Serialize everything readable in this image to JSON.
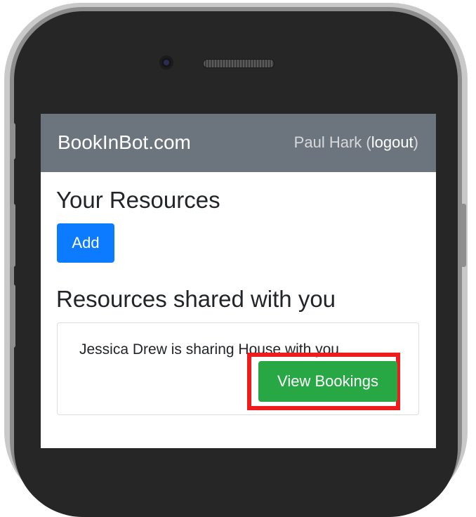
{
  "navbar": {
    "brand": "BookInBot.com",
    "user_name": "Paul Hark (",
    "logout_label": "logout",
    "user_suffix": ")"
  },
  "resources": {
    "heading": "Your Resources",
    "add_label": "Add"
  },
  "shared": {
    "heading": "Resources shared with you",
    "items": [
      {
        "text": "Jessica Drew is sharing House with you",
        "button_label": "View Bookings"
      }
    ]
  },
  "colors": {
    "navbar": "#6c757d",
    "primary": "#0d7bff",
    "success": "#28a745",
    "highlight": "#ee1c1c"
  }
}
